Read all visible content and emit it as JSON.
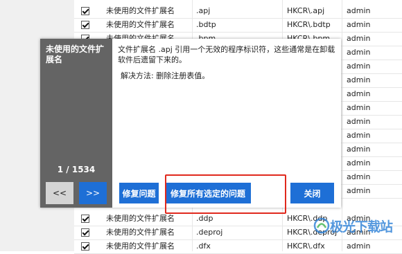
{
  "table": {
    "rows_top": [
      {
        "checked": true,
        "name": "未使用的文件扩展名",
        "value": ".apj",
        "key": "HKCR\\.apj",
        "user": "admin"
      },
      {
        "checked": true,
        "name": "未使用的文件扩展名",
        "value": ".bdtp",
        "key": "HKCR\\.bdtp",
        "user": "admin"
      },
      {
        "checked": true,
        "name": "未使用的文件扩展名",
        "value": ".bpm",
        "key": "HKCR\\.bpm",
        "user": "admin"
      }
    ],
    "side_users": [
      "admin",
      "admin",
      "admin",
      "admin",
      "admin",
      "admin",
      "admin",
      "admin",
      "admin",
      "admin",
      "admin"
    ],
    "rows_bottom": [
      {
        "checked": true,
        "name": "未使用的文件扩展名",
        "value": ".ddp",
        "key": "HKCR\\.ddp",
        "user": "admin"
      },
      {
        "checked": true,
        "name": "未使用的文件扩展名",
        "value": ".deproj",
        "key": "HKCR\\.deproj",
        "user": "admin"
      },
      {
        "checked": true,
        "name": "未使用的文件扩展名",
        "value": ".dfx",
        "key": "HKCR\\.dfx",
        "user": "admin"
      }
    ]
  },
  "dialog": {
    "title": "未使用的文件扩展名",
    "counter": "1 / 1534",
    "prev_label": "<<",
    "next_label": ">>",
    "description": "文件扩展名 .apj 引用一个无效的程序标识符，这些通常是在卸载软件后遗留下来的。",
    "solution": "解决方法: 删除注册表值。",
    "fix_label": "修复问题",
    "fix_all_label": "修复所有选定的问题",
    "close_label": "关闭"
  },
  "watermark": {
    "text": "极光下载站",
    "logo": "aurora-logo-icon"
  },
  "colors": {
    "accent": "#1e6fd6",
    "panel": "#646464",
    "highlight": "#e0281c"
  }
}
